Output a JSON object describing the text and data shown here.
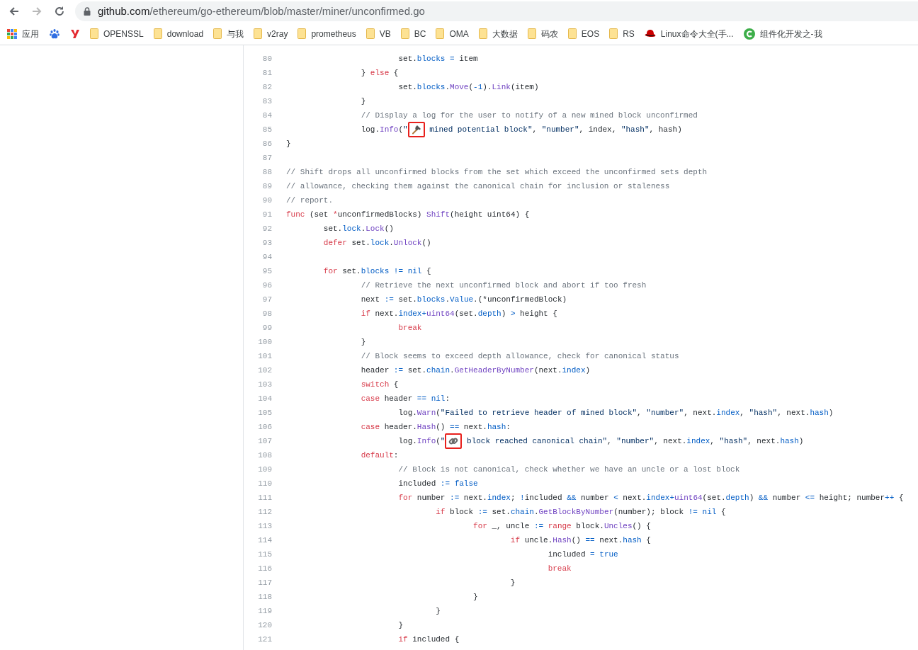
{
  "toolbar": {
    "back": {
      "disabled": false
    },
    "forward": {
      "disabled": true
    },
    "url": {
      "host": "github.com",
      "path": "/ethereum/go-ethereum/blob/master/miner/unconfirmed.go"
    }
  },
  "bookmarks": [
    {
      "kind": "apps",
      "label": "应用"
    },
    {
      "kind": "paw"
    },
    {
      "kind": "y"
    },
    {
      "kind": "folder",
      "label": "OPENSSL"
    },
    {
      "kind": "folder",
      "label": "download"
    },
    {
      "kind": "folder",
      "label": "与我"
    },
    {
      "kind": "folder",
      "label": "v2ray"
    },
    {
      "kind": "folder",
      "label": "prometheus"
    },
    {
      "kind": "folder",
      "label": "VB"
    },
    {
      "kind": "folder",
      "label": "BC"
    },
    {
      "kind": "folder",
      "label": "OMA"
    },
    {
      "kind": "folder",
      "label": "大数据"
    },
    {
      "kind": "folder",
      "label": "码农"
    },
    {
      "kind": "folder",
      "label": "EOS"
    },
    {
      "kind": "folder",
      "label": "RS"
    },
    {
      "kind": "hat",
      "label": "Linux命令大全(手..."
    },
    {
      "kind": "c",
      "label": "组件化开发之-我"
    }
  ],
  "code": [
    {
      "n": "80",
      "tokens": [
        {
          "kind": "p",
          "t": "\t\t\tset."
        },
        {
          "kind": "v",
          "t": "blocks"
        },
        {
          "kind": "v",
          "t": " ="
        },
        {
          "kind": "p",
          "t": " item"
        }
      ]
    },
    {
      "n": "81",
      "tokens": [
        {
          "kind": "p",
          "t": "\t\t} "
        },
        {
          "kind": "kw",
          "t": "else"
        },
        {
          "kind": "p",
          "t": " {"
        }
      ]
    },
    {
      "n": "82",
      "tokens": [
        {
          "kind": "p",
          "t": "\t\t\tset."
        },
        {
          "kind": "v",
          "t": "blocks"
        },
        {
          "kind": "p",
          "t": "."
        },
        {
          "kind": "f",
          "t": "Move"
        },
        {
          "kind": "p",
          "t": "("
        },
        {
          "kind": "v",
          "t": "-1"
        },
        {
          "kind": "p",
          "t": ")."
        },
        {
          "kind": "f",
          "t": "Link"
        },
        {
          "kind": "p",
          "t": "(item)"
        }
      ]
    },
    {
      "n": "83",
      "tokens": [
        {
          "kind": "p",
          "t": "\t\t}"
        }
      ]
    },
    {
      "n": "84",
      "tokens": [
        {
          "kind": "c",
          "t": "\t\t// Display a log for the user to notify of a new mined block unconfirmed"
        }
      ]
    },
    {
      "n": "85",
      "tokens": [
        {
          "kind": "p",
          "t": "\t\tlog."
        },
        {
          "kind": "f",
          "t": "Info"
        },
        {
          "kind": "p",
          "t": "("
        },
        {
          "kind": "s",
          "t": "\""
        },
        {
          "kind": "hammer",
          "boxed": true
        },
        {
          "kind": "s",
          "t": " mined potential block\""
        },
        {
          "kind": "p",
          "t": ", "
        },
        {
          "kind": "s",
          "t": "\"number\""
        },
        {
          "kind": "p",
          "t": ", index, "
        },
        {
          "kind": "s",
          "t": "\"hash\""
        },
        {
          "kind": "p",
          "t": ", hash)"
        }
      ]
    },
    {
      "n": "86",
      "tokens": [
        {
          "kind": "p",
          "t": "}"
        }
      ]
    },
    {
      "n": "87"
    },
    {
      "n": "88",
      "tokens": [
        {
          "kind": "c",
          "t": "// Shift drops all unconfirmed blocks from the set which exceed the unconfirmed sets depth"
        }
      ]
    },
    {
      "n": "89",
      "tokens": [
        {
          "kind": "c",
          "t": "// allowance, checking them against the canonical chain for inclusion or staleness"
        }
      ]
    },
    {
      "n": "90",
      "tokens": [
        {
          "kind": "c",
          "t": "// report."
        }
      ]
    },
    {
      "n": "91",
      "tokens": [
        {
          "kind": "kw",
          "t": "func"
        },
        {
          "kind": "p",
          "t": " (set "
        },
        {
          "kind": "kw",
          "t": "*"
        },
        {
          "kind": "p",
          "t": "unconfirmedBlocks) "
        },
        {
          "kind": "f",
          "t": "Shift"
        },
        {
          "kind": "p",
          "t": "(height uint64) {"
        }
      ]
    },
    {
      "n": "92",
      "tokens": [
        {
          "kind": "p",
          "t": "\tset."
        },
        {
          "kind": "v",
          "t": "lock"
        },
        {
          "kind": "p",
          "t": "."
        },
        {
          "kind": "f",
          "t": "Lock"
        },
        {
          "kind": "p",
          "t": "()"
        }
      ]
    },
    {
      "n": "93",
      "tokens": [
        {
          "kind": "kw",
          "t": "\tdefer"
        },
        {
          "kind": "p",
          "t": " set."
        },
        {
          "kind": "v",
          "t": "lock"
        },
        {
          "kind": "p",
          "t": "."
        },
        {
          "kind": "f",
          "t": "Unlock"
        },
        {
          "kind": "p",
          "t": "()"
        }
      ]
    },
    {
      "n": "94"
    },
    {
      "n": "95",
      "tokens": [
        {
          "kind": "kw",
          "t": "\tfor"
        },
        {
          "kind": "p",
          "t": " set."
        },
        {
          "kind": "v",
          "t": "blocks"
        },
        {
          "kind": "v",
          "t": " !="
        },
        {
          "kind": "v",
          "t": " nil"
        },
        {
          "kind": "p",
          "t": " {"
        }
      ]
    },
    {
      "n": "96",
      "tokens": [
        {
          "kind": "c",
          "t": "\t\t// Retrieve the next unconfirmed block and abort if too fresh"
        }
      ]
    },
    {
      "n": "97",
      "tokens": [
        {
          "kind": "p",
          "t": "\t\tnext "
        },
        {
          "kind": "v",
          "t": ":="
        },
        {
          "kind": "p",
          "t": " set."
        },
        {
          "kind": "v",
          "t": "blocks"
        },
        {
          "kind": "p",
          "t": "."
        },
        {
          "kind": "v",
          "t": "Value"
        },
        {
          "kind": "p",
          "t": ".(*unconfirmedBlock)"
        }
      ]
    },
    {
      "n": "98",
      "tokens": [
        {
          "kind": "kw",
          "t": "\t\tif"
        },
        {
          "kind": "p",
          "t": " next."
        },
        {
          "kind": "v",
          "t": "index"
        },
        {
          "kind": "v",
          "t": "+"
        },
        {
          "kind": "f",
          "t": "uint64"
        },
        {
          "kind": "p",
          "t": "(set."
        },
        {
          "kind": "v",
          "t": "depth"
        },
        {
          "kind": "p",
          "t": ") "
        },
        {
          "kind": "v",
          "t": ">"
        },
        {
          "kind": "p",
          "t": " height {"
        }
      ]
    },
    {
      "n": "99",
      "tokens": [
        {
          "kind": "kw",
          "t": "\t\t\tbreak"
        }
      ]
    },
    {
      "n": "100",
      "tokens": [
        {
          "kind": "p",
          "t": "\t\t}"
        }
      ]
    },
    {
      "n": "101",
      "tokens": [
        {
          "kind": "c",
          "t": "\t\t// Block seems to exceed depth allowance, check for canonical status"
        }
      ]
    },
    {
      "n": "102",
      "tokens": [
        {
          "kind": "p",
          "t": "\t\theader "
        },
        {
          "kind": "v",
          "t": ":="
        },
        {
          "kind": "p",
          "t": " set."
        },
        {
          "kind": "v",
          "t": "chain"
        },
        {
          "kind": "p",
          "t": "."
        },
        {
          "kind": "f",
          "t": "GetHeaderByNumber"
        },
        {
          "kind": "p",
          "t": "(next."
        },
        {
          "kind": "v",
          "t": "index"
        },
        {
          "kind": "p",
          "t": ")"
        }
      ]
    },
    {
      "n": "103",
      "tokens": [
        {
          "kind": "kw",
          "t": "\t\tswitch"
        },
        {
          "kind": "p",
          "t": " {"
        }
      ]
    },
    {
      "n": "104",
      "tokens": [
        {
          "kind": "kw",
          "t": "\t\tcase"
        },
        {
          "kind": "p",
          "t": " header "
        },
        {
          "kind": "v",
          "t": "=="
        },
        {
          "kind": "v",
          "t": " nil"
        },
        {
          "kind": "p",
          "t": ":"
        }
      ]
    },
    {
      "n": "105",
      "tokens": [
        {
          "kind": "p",
          "t": "\t\t\tlog."
        },
        {
          "kind": "f",
          "t": "Warn"
        },
        {
          "kind": "p",
          "t": "("
        },
        {
          "kind": "s",
          "t": "\"Failed to retrieve header of mined block\""
        },
        {
          "kind": "p",
          "t": ", "
        },
        {
          "kind": "s",
          "t": "\"number\""
        },
        {
          "kind": "p",
          "t": ", next."
        },
        {
          "kind": "v",
          "t": "index"
        },
        {
          "kind": "p",
          "t": ", "
        },
        {
          "kind": "s",
          "t": "\"hash\""
        },
        {
          "kind": "p",
          "t": ", next."
        },
        {
          "kind": "v",
          "t": "hash"
        },
        {
          "kind": "p",
          "t": ")"
        }
      ]
    },
    {
      "n": "106",
      "tokens": [
        {
          "kind": "kw",
          "t": "\t\tcase"
        },
        {
          "kind": "p",
          "t": " header."
        },
        {
          "kind": "f",
          "t": "Hash"
        },
        {
          "kind": "p",
          "t": "() "
        },
        {
          "kind": "v",
          "t": "=="
        },
        {
          "kind": "p",
          "t": " next."
        },
        {
          "kind": "v",
          "t": "hash"
        },
        {
          "kind": "p",
          "t": ":"
        }
      ]
    },
    {
      "n": "107",
      "tokens": [
        {
          "kind": "p",
          "t": "\t\t\tlog."
        },
        {
          "kind": "f",
          "t": "Info"
        },
        {
          "kind": "p",
          "t": "("
        },
        {
          "kind": "s",
          "t": "\""
        },
        {
          "kind": "link",
          "boxed": true
        },
        {
          "kind": "s",
          "t": " block reached canonical chain\""
        },
        {
          "kind": "p",
          "t": ", "
        },
        {
          "kind": "s",
          "t": "\"number\""
        },
        {
          "kind": "p",
          "t": ", next."
        },
        {
          "kind": "v",
          "t": "index"
        },
        {
          "kind": "p",
          "t": ", "
        },
        {
          "kind": "s",
          "t": "\"hash\""
        },
        {
          "kind": "p",
          "t": ", next."
        },
        {
          "kind": "v",
          "t": "hash"
        },
        {
          "kind": "p",
          "t": ")"
        }
      ]
    },
    {
      "n": "108",
      "tokens": [
        {
          "kind": "kw",
          "t": "\t\tdefault"
        },
        {
          "kind": "p",
          "t": ":"
        }
      ]
    },
    {
      "n": "109",
      "tokens": [
        {
          "kind": "c",
          "t": "\t\t\t// Block is not canonical, check whether we have an uncle or a lost block"
        }
      ]
    },
    {
      "n": "110",
      "tokens": [
        {
          "kind": "p",
          "t": "\t\t\tincluded "
        },
        {
          "kind": "v",
          "t": ":="
        },
        {
          "kind": "v",
          "t": " false"
        }
      ]
    },
    {
      "n": "111",
      "tokens": [
        {
          "kind": "kw",
          "t": "\t\t\tfor"
        },
        {
          "kind": "p",
          "t": " number "
        },
        {
          "kind": "v",
          "t": ":="
        },
        {
          "kind": "p",
          "t": " next."
        },
        {
          "kind": "v",
          "t": "index"
        },
        {
          "kind": "p",
          "t": "; "
        },
        {
          "kind": "v",
          "t": "!"
        },
        {
          "kind": "p",
          "t": "included "
        },
        {
          "kind": "v",
          "t": "&&"
        },
        {
          "kind": "p",
          "t": " number "
        },
        {
          "kind": "v",
          "t": "<"
        },
        {
          "kind": "p",
          "t": " next."
        },
        {
          "kind": "v",
          "t": "index"
        },
        {
          "kind": "v",
          "t": "+"
        },
        {
          "kind": "f",
          "t": "uint64"
        },
        {
          "kind": "p",
          "t": "(set."
        },
        {
          "kind": "v",
          "t": "depth"
        },
        {
          "kind": "p",
          "t": ") "
        },
        {
          "kind": "v",
          "t": "&&"
        },
        {
          "kind": "p",
          "t": " number "
        },
        {
          "kind": "v",
          "t": "<="
        },
        {
          "kind": "p",
          "t": " height; number"
        },
        {
          "kind": "v",
          "t": "++"
        },
        {
          "kind": "p",
          "t": " {"
        }
      ]
    },
    {
      "n": "112",
      "tokens": [
        {
          "kind": "kw",
          "t": "\t\t\t\tif"
        },
        {
          "kind": "p",
          "t": " block "
        },
        {
          "kind": "v",
          "t": ":="
        },
        {
          "kind": "p",
          "t": " set."
        },
        {
          "kind": "v",
          "t": "chain"
        },
        {
          "kind": "p",
          "t": "."
        },
        {
          "kind": "f",
          "t": "GetBlockByNumber"
        },
        {
          "kind": "p",
          "t": "(number); block "
        },
        {
          "kind": "v",
          "t": "!="
        },
        {
          "kind": "v",
          "t": " nil"
        },
        {
          "kind": "p",
          "t": " {"
        }
      ]
    },
    {
      "n": "113",
      "tokens": [
        {
          "kind": "kw",
          "t": "\t\t\t\t\tfor"
        },
        {
          "kind": "p",
          "t": " _, uncle "
        },
        {
          "kind": "v",
          "t": ":="
        },
        {
          "kind": "kw",
          "t": " range"
        },
        {
          "kind": "p",
          "t": " block."
        },
        {
          "kind": "f",
          "t": "Uncles"
        },
        {
          "kind": "p",
          "t": "() {"
        }
      ]
    },
    {
      "n": "114",
      "tokens": [
        {
          "kind": "kw",
          "t": "\t\t\t\t\t\tif"
        },
        {
          "kind": "p",
          "t": " uncle."
        },
        {
          "kind": "f",
          "t": "Hash"
        },
        {
          "kind": "p",
          "t": "() "
        },
        {
          "kind": "v",
          "t": "=="
        },
        {
          "kind": "p",
          "t": " next."
        },
        {
          "kind": "v",
          "t": "hash"
        },
        {
          "kind": "p",
          "t": " {"
        }
      ]
    },
    {
      "n": "115",
      "tokens": [
        {
          "kind": "p",
          "t": "\t\t\t\t\t\t\tincluded "
        },
        {
          "kind": "v",
          "t": "="
        },
        {
          "kind": "v",
          "t": " true"
        }
      ]
    },
    {
      "n": "116",
      "tokens": [
        {
          "kind": "kw",
          "t": "\t\t\t\t\t\t\tbreak"
        }
      ]
    },
    {
      "n": "117",
      "tokens": [
        {
          "kind": "p",
          "t": "\t\t\t\t\t\t}"
        }
      ]
    },
    {
      "n": "118",
      "tokens": [
        {
          "kind": "p",
          "t": "\t\t\t\t\t}"
        }
      ]
    },
    {
      "n": "119",
      "tokens": [
        {
          "kind": "p",
          "t": "\t\t\t\t}"
        }
      ]
    },
    {
      "n": "120",
      "tokens": [
        {
          "kind": "p",
          "t": "\t\t\t}"
        }
      ]
    },
    {
      "n": "121",
      "tokens": [
        {
          "kind": "kw",
          "t": "\t\t\tif"
        },
        {
          "kind": "p",
          "t": " included {"
        }
      ]
    }
  ]
}
